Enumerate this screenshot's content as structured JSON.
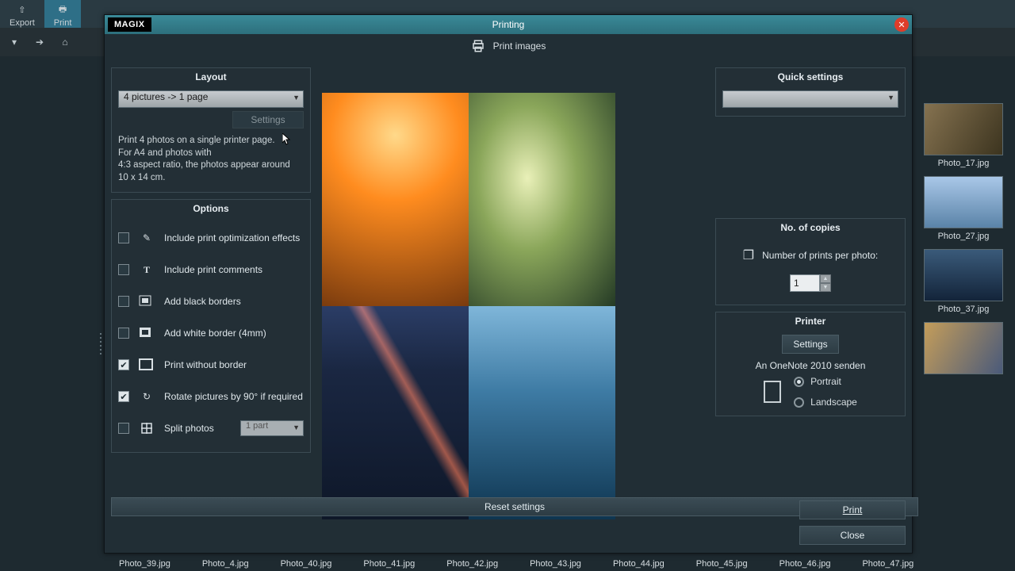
{
  "toolbar": {
    "export_label": "Export",
    "print_label": "Print"
  },
  "thumbs_right": [
    {
      "label": "Photo_17.jpg"
    },
    {
      "label": "Photo_27.jpg"
    },
    {
      "label": "Photo_37.jpg"
    },
    {
      "label": ""
    }
  ],
  "filmstrip": [
    "Photo_39.jpg",
    "Photo_4.jpg",
    "Photo_40.jpg",
    "Photo_41.jpg",
    "Photo_42.jpg",
    "Photo_43.jpg",
    "Photo_44.jpg",
    "Photo_45.jpg",
    "Photo_46.jpg",
    "Photo_47.jpg"
  ],
  "dialog": {
    "brand": "MAGIX",
    "title": "Printing",
    "subhead": "Print images",
    "layout": {
      "heading": "Layout",
      "selected": "4 pictures -> 1 page",
      "settings_btn": "Settings",
      "description": "Print 4 photos on a single printer page.\nFor A4 and photos with\n4:3 aspect ratio, the photos appear around\n10 x 14 cm."
    },
    "options": {
      "heading": "Options",
      "rows": [
        {
          "label": "Include print optimization effects",
          "checked": false,
          "icon": "pencil-icon"
        },
        {
          "label": "Include print comments",
          "checked": false,
          "icon": "text-icon"
        },
        {
          "label": "Add black borders",
          "checked": false,
          "icon": "border-black-icon"
        },
        {
          "label": "Add white border (4mm)",
          "checked": false,
          "icon": "border-white-icon"
        },
        {
          "label": "Print without border",
          "checked": true,
          "icon": "no-border-icon"
        },
        {
          "label": "Rotate pictures by 90° if required",
          "checked": true,
          "icon": "rotate-icon"
        },
        {
          "label": "Split photos",
          "checked": false,
          "icon": "split-icon",
          "select": "1 part"
        }
      ]
    },
    "quick": {
      "heading": "Quick settings",
      "selected": ""
    },
    "copies": {
      "heading": "No. of copies",
      "label": "Number of prints per photo:",
      "value": "1"
    },
    "printer": {
      "heading": "Printer",
      "settings_btn": "Settings",
      "name": "An OneNote 2010 senden",
      "orientation": {
        "portrait": "Portrait",
        "landscape": "Landscape",
        "selected": "portrait"
      }
    },
    "buttons": {
      "reset": "Reset settings",
      "print": "Print",
      "close": "Close"
    }
  }
}
